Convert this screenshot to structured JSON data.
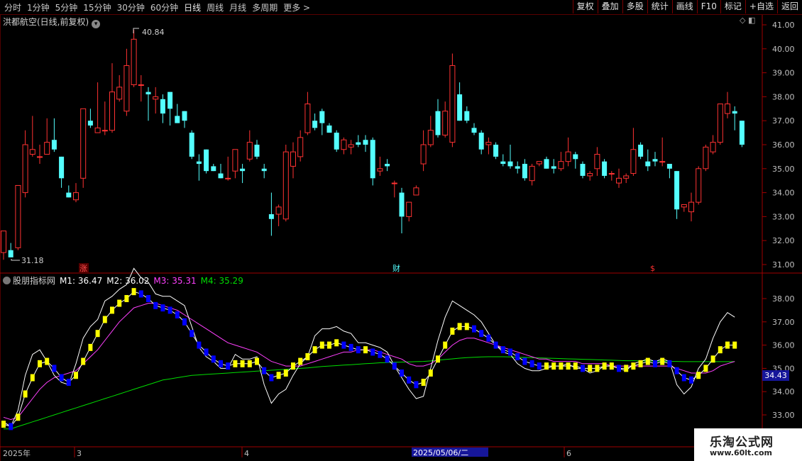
{
  "toolbar": {
    "periods": [
      "分时",
      "1分钟",
      "5分钟",
      "15分钟",
      "30分钟",
      "60分钟",
      "日线",
      "周线",
      "月线",
      "多周期",
      "更多 >"
    ],
    "tools": [
      "复权",
      "叠加",
      "多股",
      "统计",
      "画线",
      "F10",
      "标记",
      "+自选",
      "返回"
    ]
  },
  "chart": {
    "title": "洪都航空(日线,前复权)",
    "high_label": "40.84",
    "low_label": "31.18",
    "price_ticks": [
      "41.00",
      "40.00",
      "39.00",
      "38.00",
      "37.00",
      "36.00",
      "35.00",
      "34.00",
      "33.00",
      "32.00",
      "31.00"
    ],
    "markers": [
      "涨",
      "财",
      "$"
    ]
  },
  "indicator": {
    "name": "股朋指标网",
    "m1_label": "M1: 36.47",
    "m2_label": "M2: 36.02",
    "m3_label": "M3: 35.31",
    "m4_label": "M4: 35.29",
    "ticks": [
      "38.00",
      "37.00",
      "36.00",
      "35.00",
      "34.00",
      "33.00"
    ],
    "last_value": "34.43"
  },
  "dates": [
    "2025年",
    "3",
    "4",
    "2025/05/06/二",
    "6"
  ],
  "watermark": {
    "line1": "乐淘公式网",
    "line2": "www.60lt.com"
  },
  "colors": {
    "up": "#ff3232",
    "down": "#54ffff",
    "m1": "#ffffff",
    "m3": "#ff40ff",
    "m4": "#00dd00",
    "rising": "#ffff00",
    "falling": "#0000ff"
  },
  "chart_data": {
    "type": "candlestick",
    "ylim": [
      30.9,
      41.2
    ],
    "indicator_ylim": [
      32.4,
      38.9
    ],
    "candles": [
      {
        "o": 31.5,
        "h": 32.4,
        "l": 31.2,
        "c": 32.4
      },
      {
        "o": 31.6,
        "h": 31.9,
        "l": 31.3,
        "c": 31.3
      },
      {
        "o": 31.7,
        "h": 34.3,
        "l": 31.6,
        "c": 34.3
      },
      {
        "o": 34.0,
        "h": 36.6,
        "l": 33.8,
        "c": 36.0
      },
      {
        "o": 35.6,
        "h": 37.2,
        "l": 35.5,
        "c": 35.8
      },
      {
        "o": 35.5,
        "h": 36.0,
        "l": 35.2,
        "c": 35.5
      },
      {
        "o": 35.6,
        "h": 37.1,
        "l": 35.6,
        "c": 36.1
      },
      {
        "o": 36.2,
        "h": 37.1,
        "l": 35.7,
        "c": 35.8
      },
      {
        "o": 35.5,
        "h": 35.5,
        "l": 34.2,
        "c": 34.6
      },
      {
        "o": 34.0,
        "h": 34.3,
        "l": 33.8,
        "c": 33.8
      },
      {
        "o": 33.7,
        "h": 34.4,
        "l": 33.6,
        "c": 34.0
      },
      {
        "o": 34.6,
        "h": 37.2,
        "l": 34.2,
        "c": 37.5
      },
      {
        "o": 37.0,
        "h": 37.5,
        "l": 36.7,
        "c": 36.8
      },
      {
        "o": 36.5,
        "h": 38.6,
        "l": 36.5,
        "c": 36.7
      },
      {
        "o": 36.6,
        "h": 37.8,
        "l": 36.4,
        "c": 36.6
      },
      {
        "o": 36.6,
        "h": 39.4,
        "l": 36.5,
        "c": 38.2
      },
      {
        "o": 37.9,
        "h": 38.9,
        "l": 37.8,
        "c": 38.4
      },
      {
        "o": 37.4,
        "h": 40.0,
        "l": 37.2,
        "c": 39.3
      },
      {
        "o": 38.5,
        "h": 40.8,
        "l": 38.4,
        "c": 40.4
      },
      {
        "o": 38.5,
        "h": 38.9,
        "l": 37.8,
        "c": 38.5
      },
      {
        "o": 38.2,
        "h": 38.4,
        "l": 37.0,
        "c": 38.1
      },
      {
        "o": 37.9,
        "h": 38.4,
        "l": 37.3,
        "c": 38.0
      },
      {
        "o": 37.9,
        "h": 38.1,
        "l": 36.9,
        "c": 37.3
      },
      {
        "o": 38.2,
        "h": 38.2,
        "l": 36.8,
        "c": 37.5
      },
      {
        "o": 37.2,
        "h": 37.7,
        "l": 36.9,
        "c": 36.9
      },
      {
        "o": 37.4,
        "h": 37.4,
        "l": 36.7,
        "c": 37.0
      },
      {
        "o": 36.5,
        "h": 36.6,
        "l": 35.4,
        "c": 35.5
      },
      {
        "o": 35.3,
        "h": 35.6,
        "l": 34.5,
        "c": 35.2
      },
      {
        "o": 35.8,
        "h": 35.8,
        "l": 34.8,
        "c": 34.9
      },
      {
        "o": 35.1,
        "h": 35.2,
        "l": 34.9,
        "c": 34.9
      },
      {
        "o": 34.8,
        "h": 35.2,
        "l": 34.6,
        "c": 34.6
      },
      {
        "o": 34.6,
        "h": 35.5,
        "l": 34.5,
        "c": 34.6
      },
      {
        "o": 34.9,
        "h": 35.7,
        "l": 34.6,
        "c": 35.8
      },
      {
        "o": 35.0,
        "h": 35.2,
        "l": 34.4,
        "c": 34.9
      },
      {
        "o": 35.4,
        "h": 36.6,
        "l": 35.3,
        "c": 36.1
      },
      {
        "o": 36.0,
        "h": 36.2,
        "l": 35.4,
        "c": 35.5
      },
      {
        "o": 35.0,
        "h": 35.2,
        "l": 34.6,
        "c": 34.9
      },
      {
        "o": 33.1,
        "h": 34.0,
        "l": 32.2,
        "c": 32.9
      },
      {
        "o": 33.1,
        "h": 33.5,
        "l": 32.6,
        "c": 33.4
      },
      {
        "o": 32.9,
        "h": 36.0,
        "l": 32.8,
        "c": 35.7
      },
      {
        "o": 35.1,
        "h": 36.1,
        "l": 34.6,
        "c": 35.7
      },
      {
        "o": 35.5,
        "h": 36.6,
        "l": 35.3,
        "c": 36.3
      },
      {
        "o": 36.5,
        "h": 38.2,
        "l": 36.4,
        "c": 37.7
      },
      {
        "o": 37.0,
        "h": 37.3,
        "l": 36.6,
        "c": 36.7
      },
      {
        "o": 37.4,
        "h": 37.5,
        "l": 36.4,
        "c": 36.9
      },
      {
        "o": 36.8,
        "h": 36.9,
        "l": 36.5,
        "c": 36.5
      },
      {
        "o": 36.5,
        "h": 36.6,
        "l": 35.7,
        "c": 35.8
      },
      {
        "o": 35.8,
        "h": 36.3,
        "l": 35.6,
        "c": 36.2
      },
      {
        "o": 35.9,
        "h": 36.2,
        "l": 35.6,
        "c": 36.0
      },
      {
        "o": 36.1,
        "h": 36.4,
        "l": 35.9,
        "c": 36.0
      },
      {
        "o": 36.2,
        "h": 36.4,
        "l": 35.7,
        "c": 36.0
      },
      {
        "o": 36.2,
        "h": 36.3,
        "l": 34.3,
        "c": 34.6
      },
      {
        "o": 34.9,
        "h": 35.5,
        "l": 34.7,
        "c": 35.0
      },
      {
        "o": 35.2,
        "h": 35.4,
        "l": 34.9,
        "c": 35.1
      },
      {
        "o": 34.4,
        "h": 34.5,
        "l": 33.8,
        "c": 34.4
      },
      {
        "o": 34.0,
        "h": 34.2,
        "l": 32.3,
        "c": 33.0
      },
      {
        "o": 33.0,
        "h": 33.6,
        "l": 32.8,
        "c": 33.6
      },
      {
        "o": 33.9,
        "h": 34.3,
        "l": 33.9,
        "c": 34.2
      },
      {
        "o": 35.2,
        "h": 36.6,
        "l": 34.9,
        "c": 36.0
      },
      {
        "o": 36.0,
        "h": 37.2,
        "l": 35.9,
        "c": 36.6
      },
      {
        "o": 37.4,
        "h": 37.9,
        "l": 36.3,
        "c": 36.4
      },
      {
        "o": 36.4,
        "h": 37.8,
        "l": 36.3,
        "c": 37.4
      },
      {
        "o": 36.1,
        "h": 39.8,
        "l": 35.9,
        "c": 39.3
      },
      {
        "o": 38.1,
        "h": 38.6,
        "l": 37.0,
        "c": 37.0
      },
      {
        "o": 37.4,
        "h": 37.6,
        "l": 36.9,
        "c": 37.0
      },
      {
        "o": 36.7,
        "h": 36.9,
        "l": 36.4,
        "c": 36.5
      },
      {
        "o": 36.5,
        "h": 36.6,
        "l": 35.6,
        "c": 35.8
      },
      {
        "o": 36.0,
        "h": 36.3,
        "l": 35.6,
        "c": 36.1
      },
      {
        "o": 36.0,
        "h": 36.1,
        "l": 35.4,
        "c": 35.5
      },
      {
        "o": 35.3,
        "h": 35.6,
        "l": 35.1,
        "c": 35.2
      },
      {
        "o": 35.3,
        "h": 36.0,
        "l": 35.0,
        "c": 35.1
      },
      {
        "o": 35.1,
        "h": 35.3,
        "l": 34.8,
        "c": 35.0
      },
      {
        "o": 35.2,
        "h": 35.4,
        "l": 34.5,
        "c": 34.6
      },
      {
        "o": 34.5,
        "h": 35.2,
        "l": 34.3,
        "c": 35.1
      },
      {
        "o": 35.2,
        "h": 35.3,
        "l": 35.1,
        "c": 35.3
      },
      {
        "o": 35.4,
        "h": 35.5,
        "l": 35.0,
        "c": 35.0
      },
      {
        "o": 35.1,
        "h": 35.4,
        "l": 34.8,
        "c": 35.0
      },
      {
        "o": 35.0,
        "h": 35.7,
        "l": 34.9,
        "c": 35.3
      },
      {
        "o": 35.3,
        "h": 36.3,
        "l": 35.1,
        "c": 35.7
      },
      {
        "o": 35.6,
        "h": 35.7,
        "l": 35.0,
        "c": 35.4
      },
      {
        "o": 35.2,
        "h": 35.3,
        "l": 34.6,
        "c": 34.7
      },
      {
        "o": 34.7,
        "h": 34.9,
        "l": 34.5,
        "c": 34.8
      },
      {
        "o": 35.0,
        "h": 35.9,
        "l": 34.7,
        "c": 35.6
      },
      {
        "o": 35.3,
        "h": 35.4,
        "l": 34.6,
        "c": 34.7
      },
      {
        "o": 34.8,
        "h": 34.9,
        "l": 34.5,
        "c": 34.8
      },
      {
        "o": 34.4,
        "h": 35.0,
        "l": 34.2,
        "c": 34.6
      },
      {
        "o": 34.6,
        "h": 34.8,
        "l": 34.4,
        "c": 34.7
      },
      {
        "o": 34.8,
        "h": 36.7,
        "l": 34.7,
        "c": 35.8
      },
      {
        "o": 36.0,
        "h": 36.1,
        "l": 35.4,
        "c": 35.5
      },
      {
        "o": 35.3,
        "h": 35.8,
        "l": 34.9,
        "c": 35.1
      },
      {
        "o": 35.4,
        "h": 35.7,
        "l": 35.1,
        "c": 35.3
      },
      {
        "o": 35.3,
        "h": 36.3,
        "l": 35.1,
        "c": 35.3
      },
      {
        "o": 35.2,
        "h": 35.2,
        "l": 34.6,
        "c": 35.0
      },
      {
        "o": 34.9,
        "h": 34.9,
        "l": 32.9,
        "c": 33.3
      },
      {
        "o": 33.4,
        "h": 33.5,
        "l": 33.2,
        "c": 33.5
      },
      {
        "o": 33.2,
        "h": 34.0,
        "l": 32.8,
        "c": 33.6
      },
      {
        "o": 33.6,
        "h": 35.1,
        "l": 33.5,
        "c": 35.0
      },
      {
        "o": 35.0,
        "h": 36.0,
        "l": 34.9,
        "c": 35.9
      },
      {
        "o": 35.7,
        "h": 36.4,
        "l": 35.6,
        "c": 36.1
      },
      {
        "o": 36.1,
        "h": 37.1,
        "l": 36.0,
        "c": 37.7
      },
      {
        "o": 37.3,
        "h": 38.2,
        "l": 37.1,
        "c": 37.7
      },
      {
        "o": 37.4,
        "h": 37.6,
        "l": 36.6,
        "c": 37.3
      },
      {
        "o": 37.0,
        "h": 37.0,
        "l": 35.9,
        "c": 36.0
      }
    ],
    "m1": [
      32.7,
      32.5,
      33.2,
      34.7,
      35.6,
      35.8,
      35.3,
      34.7,
      34.4,
      34.3,
      35.2,
      36.3,
      36.8,
      37.1,
      37.9,
      38.1,
      38.4,
      38.6,
      39.3,
      38.9,
      38.7,
      38.2,
      38.1,
      38.1,
      37.9,
      37.7,
      36.8,
      35.9,
      35.5,
      35.3,
      35.0,
      35.0,
      35.6,
      35.4,
      35.4,
      35.5,
      34.3,
      33.5,
      33.9,
      34.1,
      34.7,
      35.2,
      35.5,
      36.4,
      36.7,
      36.7,
      36.8,
      36.6,
      36.5,
      36.1,
      36.1,
      36.0,
      35.9,
      35.7,
      35.1,
      34.6,
      34.1,
      33.7,
      33.8,
      35.0,
      36.2,
      37.2,
      37.9,
      37.7,
      37.5,
      37.3,
      37.0,
      36.5,
      36.0,
      35.7,
      35.6,
      35.2,
      35.0,
      34.9,
      34.9,
      35.0,
      35.1,
      35.1,
      35.2,
      35.0,
      35.0,
      34.8,
      34.9,
      35.1,
      35.1,
      35.0,
      34.9,
      35.2,
      35.3,
      35.4,
      35.3,
      35.4,
      35.3,
      34.3,
      33.9,
      34.2,
      35.0,
      35.4,
      36.3,
      37.0,
      37.4,
      37.2
    ],
    "m2": [
      32.6,
      32.5,
      32.9,
      33.9,
      34.6,
      35.2,
      35.3,
      35.0,
      34.6,
      34.4,
      34.7,
      35.3,
      35.9,
      36.5,
      37.1,
      37.5,
      37.8,
      38.0,
      38.3,
      38.2,
      38.0,
      37.7,
      37.6,
      37.5,
      37.3,
      37.0,
      36.5,
      36.0,
      35.7,
      35.4,
      35.2,
      35.1,
      35.2,
      35.2,
      35.2,
      35.3,
      34.9,
      34.6,
      34.7,
      34.8,
      35.1,
      35.3,
      35.5,
      35.8,
      36.0,
      36.0,
      36.1,
      36.0,
      35.9,
      35.8,
      35.8,
      35.7,
      35.6,
      35.4,
      35.1,
      34.8,
      34.5,
      34.3,
      34.4,
      34.8,
      35.4,
      36.0,
      36.6,
      36.8,
      36.8,
      36.7,
      36.5,
      36.3,
      36.0,
      35.8,
      35.7,
      35.5,
      35.3,
      35.2,
      35.1,
      35.1,
      35.1,
      35.1,
      35.1,
      35.1,
      35.0,
      35.0,
      35.0,
      35.1,
      35.1,
      35.0,
      35.0,
      35.1,
      35.2,
      35.3,
      35.2,
      35.3,
      35.2,
      34.9,
      34.6,
      34.5,
      34.7,
      35.0,
      35.4,
      35.8,
      36.0,
      36.0
    ],
    "m3": [
      32.9,
      32.8,
      32.9,
      33.3,
      33.7,
      34.1,
      34.4,
      34.6,
      34.7,
      34.8,
      34.9,
      35.2,
      35.5,
      35.8,
      36.2,
      36.6,
      37.0,
      37.3,
      37.6,
      37.7,
      37.8,
      37.8,
      37.7,
      37.6,
      37.5,
      37.3,
      37.1,
      36.9,
      36.7,
      36.5,
      36.3,
      36.1,
      36.0,
      35.9,
      35.8,
      35.7,
      35.5,
      35.3,
      35.2,
      35.1,
      35.1,
      35.1,
      35.2,
      35.3,
      35.4,
      35.5,
      35.6,
      35.7,
      35.7,
      35.8,
      35.8,
      35.8,
      35.7,
      35.6,
      35.5,
      35.4,
      35.2,
      35.1,
      35.1,
      35.2,
      35.4,
      35.7,
      36.0,
      36.2,
      36.3,
      36.3,
      36.2,
      36.1,
      36.0,
      35.9,
      35.8,
      35.7,
      35.6,
      35.5,
      35.4,
      35.4,
      35.3,
      35.3,
      35.3,
      35.3,
      35.2,
      35.2,
      35.2,
      35.2,
      35.1,
      35.1,
      35.1,
      35.1,
      35.1,
      35.1,
      35.1,
      35.1,
      35.1,
      35.0,
      34.9,
      34.8,
      34.8,
      34.8,
      34.9,
      35.1,
      35.2,
      35.3
    ],
    "m4": [
      32.4,
      32.4,
      32.5,
      32.6,
      32.7,
      32.8,
      32.9,
      33.0,
      33.1,
      33.2,
      33.3,
      33.4,
      33.5,
      33.6,
      33.7,
      33.8,
      33.9,
      34.0,
      34.1,
      34.2,
      34.3,
      34.4,
      34.5,
      34.55,
      34.6,
      34.65,
      34.7,
      34.72,
      34.74,
      34.76,
      34.78,
      34.8,
      34.82,
      34.84,
      34.86,
      34.88,
      34.9,
      34.92,
      34.94,
      34.96,
      34.98,
      35.0,
      35.02,
      35.05,
      35.08,
      35.1,
      35.12,
      35.14,
      35.16,
      35.18,
      35.2,
      35.22,
      35.24,
      35.25,
      35.26,
      35.27,
      35.28,
      35.29,
      35.3,
      35.32,
      35.35,
      35.38,
      35.41,
      35.44,
      35.46,
      35.48,
      35.49,
      35.5,
      35.5,
      35.5,
      35.49,
      35.48,
      35.47,
      35.46,
      35.45,
      35.44,
      35.43,
      35.42,
      35.41,
      35.4,
      35.39,
      35.38,
      35.37,
      35.36,
      35.35,
      35.34,
      35.33,
      35.33,
      35.32,
      35.32,
      35.31,
      35.31,
      35.3,
      35.3,
      35.29,
      35.29,
      35.29,
      35.29,
      35.29,
      35.29,
      35.29,
      35.29
    ]
  }
}
